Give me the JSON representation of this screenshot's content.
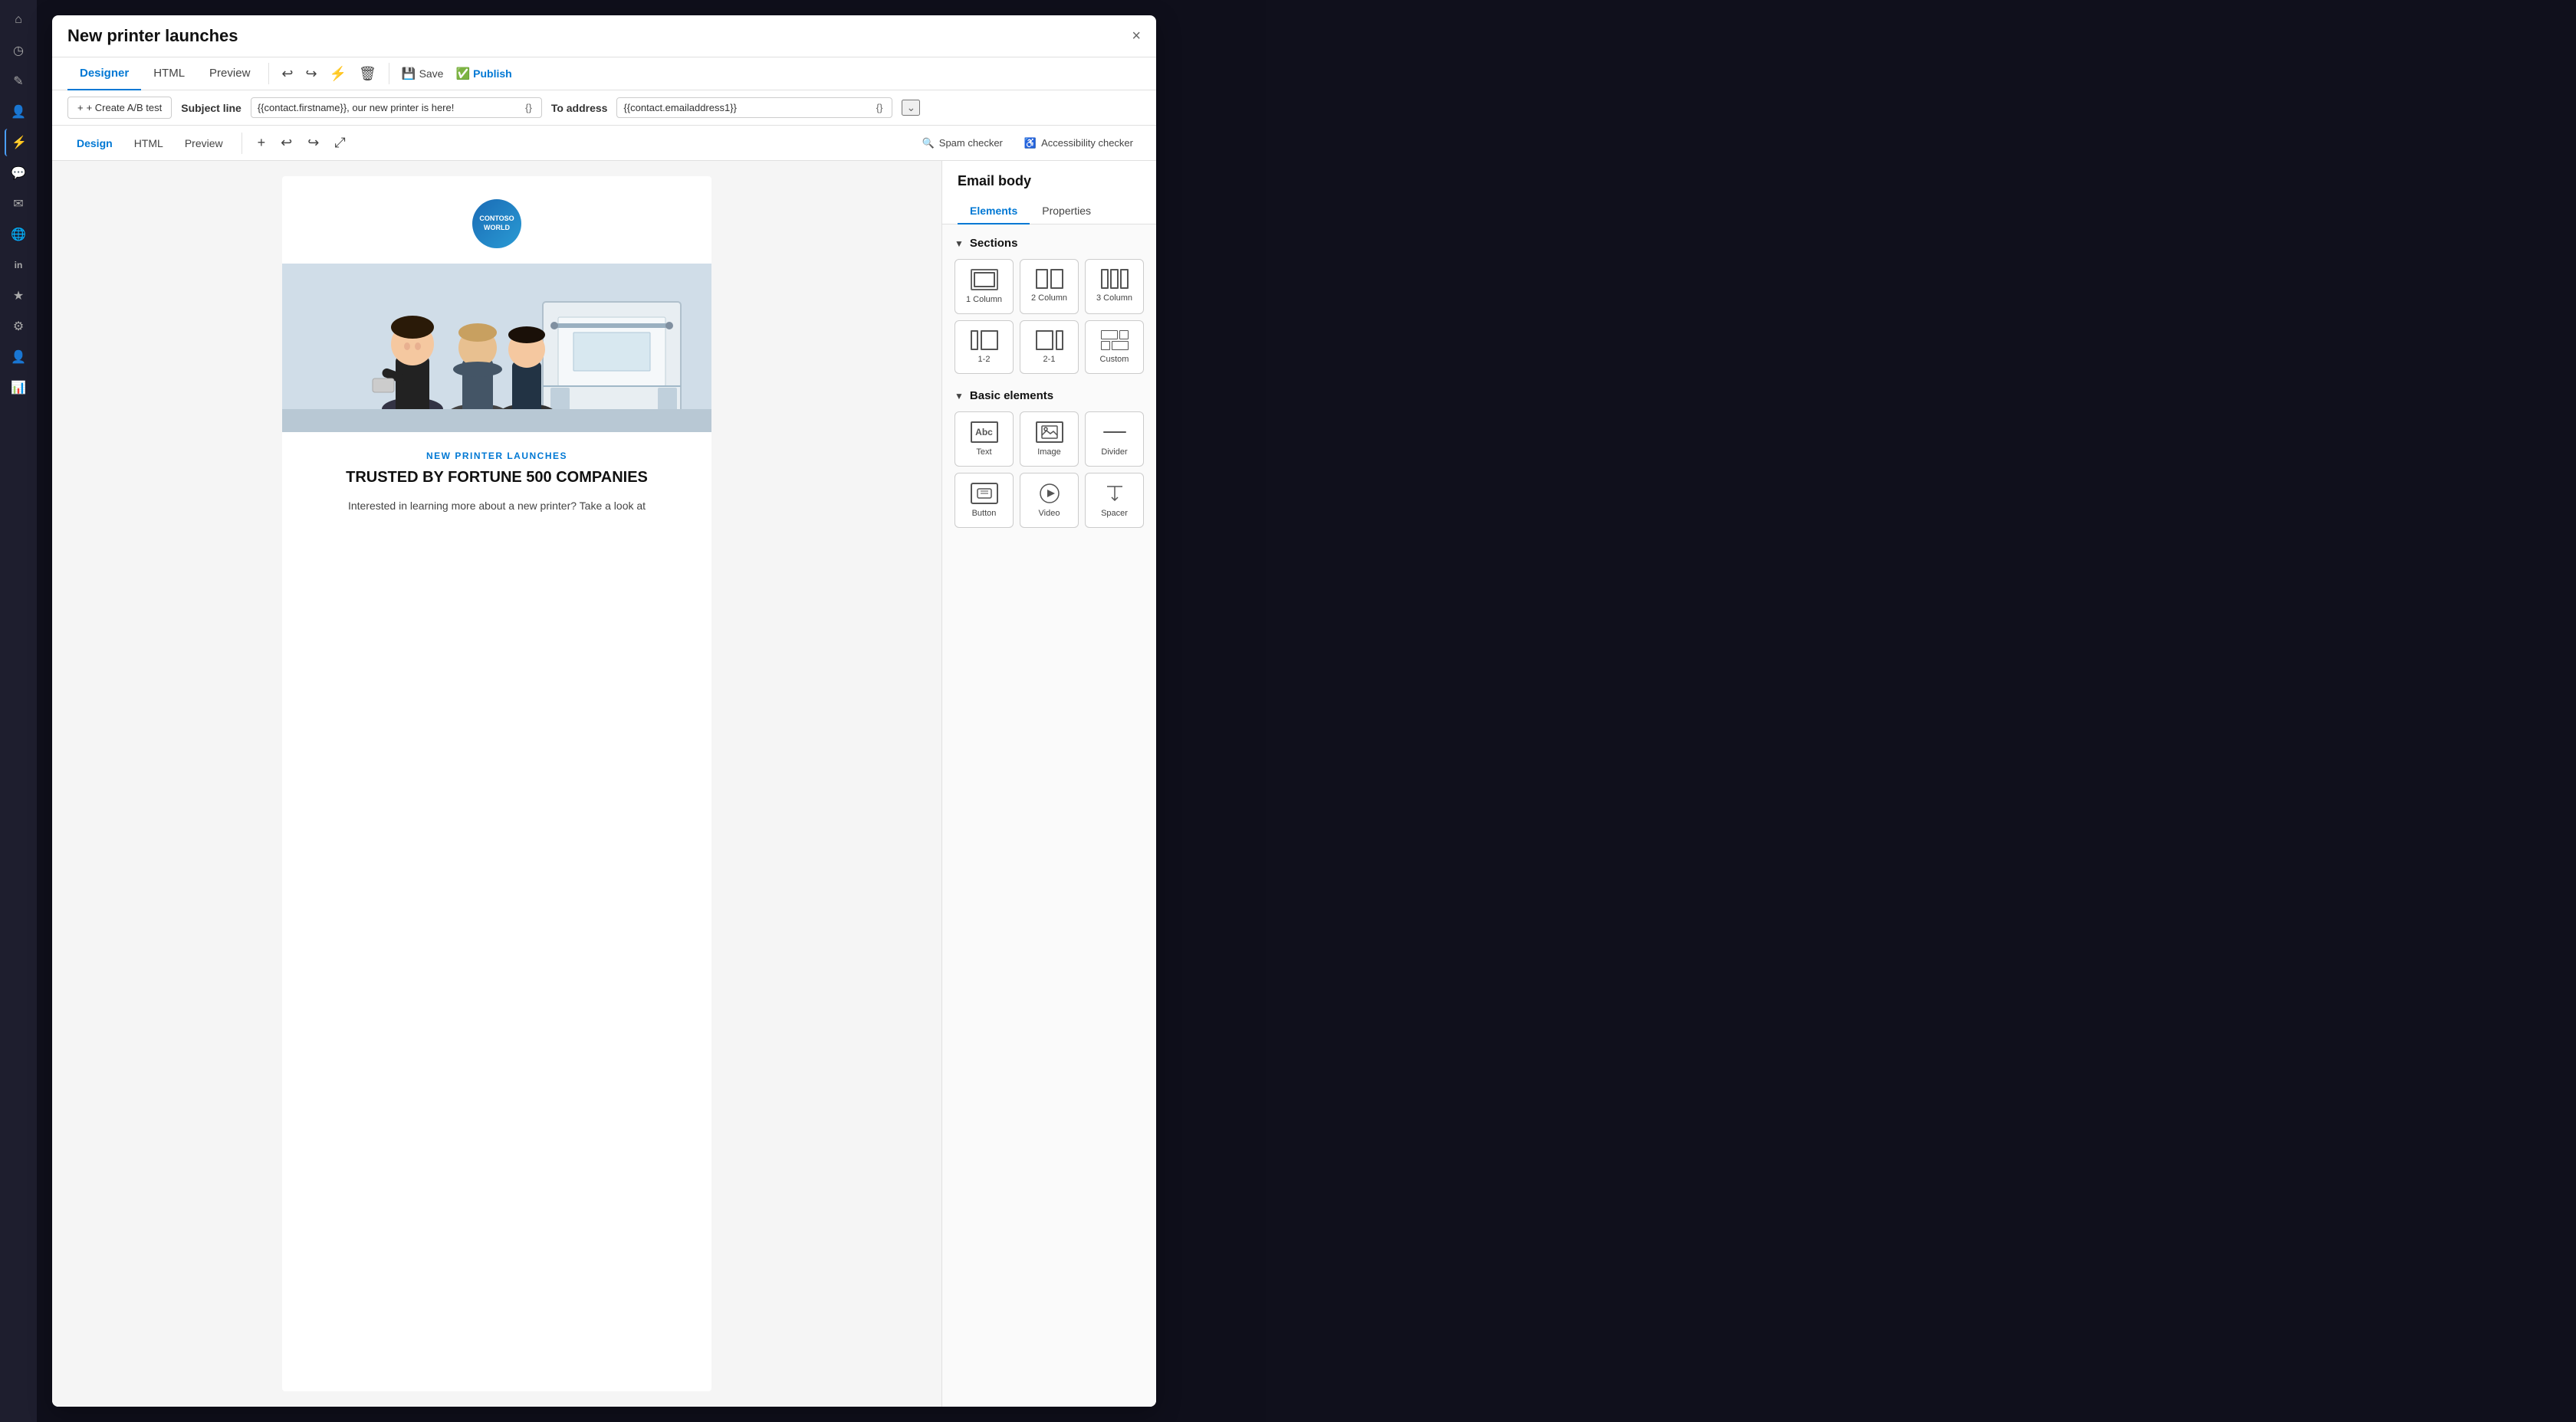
{
  "modal": {
    "title": "New printer launches",
    "close_label": "×"
  },
  "top_tabs": [
    {
      "id": "designer",
      "label": "Designer",
      "active": true
    },
    {
      "id": "html",
      "label": "HTML",
      "active": false
    },
    {
      "id": "preview",
      "label": "Preview",
      "active": false
    }
  ],
  "toolbar": {
    "undo_label": "↩",
    "redo_label": "↪",
    "personalize_label": "⚙",
    "delete_label": "🗑",
    "save_label": "Save",
    "publish_label": "Publish"
  },
  "subject_bar": {
    "create_ab_label": "+ Create A/B test",
    "subject_line_label": "Subject line",
    "subject_value": "{{contact.firstname}}, our new printer is here!",
    "curly_label": "{}",
    "to_address_label": "To address",
    "to_value": "{{contact.emailaddress1}}",
    "chevron_label": "⌄"
  },
  "design_tabs": [
    {
      "id": "design",
      "label": "Design",
      "active": true
    },
    {
      "id": "html",
      "label": "HTML",
      "active": false
    },
    {
      "id": "preview",
      "label": "Preview",
      "active": false
    }
  ],
  "design_toolbar": {
    "add_label": "+",
    "undo_label": "↩",
    "redo_label": "↪",
    "expand_label": "⤢",
    "spam_checker_label": "Spam checker",
    "accessibility_checker_label": "Accessibility checker"
  },
  "email_content": {
    "logo_text": "CONTOSO\nWORLD",
    "subtitle": "NEW PRINTER LAUNCHES",
    "heading": "TRUSTED BY FORTUNE 500 COMPANIES",
    "para": "Interested in learning more about a new printer? Take a look at"
  },
  "right_panel": {
    "title": "Email body",
    "tabs": [
      {
        "id": "elements",
        "label": "Elements",
        "active": true
      },
      {
        "id": "properties",
        "label": "Properties",
        "active": false
      }
    ],
    "sections_label": "Sections",
    "sections_chevron": "▼",
    "section_items": [
      {
        "id": "1col",
        "label": "1 Column"
      },
      {
        "id": "2col",
        "label": "2 Column"
      },
      {
        "id": "3col",
        "label": "3 Column"
      },
      {
        "id": "1-2",
        "label": "1-2"
      },
      {
        "id": "2-1",
        "label": "2-1"
      },
      {
        "id": "custom",
        "label": "Custom"
      }
    ],
    "basic_elements_label": "Basic elements",
    "basic_chevron": "▼",
    "basic_items": [
      {
        "id": "text",
        "label": "Text"
      },
      {
        "id": "image",
        "label": "Image"
      },
      {
        "id": "divider",
        "label": "Divider"
      },
      {
        "id": "button",
        "label": "Button"
      },
      {
        "id": "video",
        "label": "Video"
      },
      {
        "id": "spacer",
        "label": "Spacer"
      }
    ]
  },
  "sidebar": {
    "icons": [
      {
        "id": "home",
        "symbol": "⌂"
      },
      {
        "id": "clock",
        "symbol": "◷"
      },
      {
        "id": "pencil",
        "symbol": "✎"
      },
      {
        "id": "people",
        "symbol": "👤"
      },
      {
        "id": "channel",
        "symbol": "⚡"
      },
      {
        "id": "chat",
        "symbol": "💬"
      },
      {
        "id": "email",
        "symbol": "✉"
      },
      {
        "id": "globe",
        "symbol": "🌐"
      },
      {
        "id": "linkedin",
        "symbol": "in"
      },
      {
        "id": "custom",
        "symbol": "★"
      },
      {
        "id": "settings",
        "symbol": "⚙"
      },
      {
        "id": "user",
        "symbol": "👤"
      },
      {
        "id": "report",
        "symbol": "📊"
      },
      {
        "id": "more",
        "symbol": "…"
      }
    ]
  }
}
